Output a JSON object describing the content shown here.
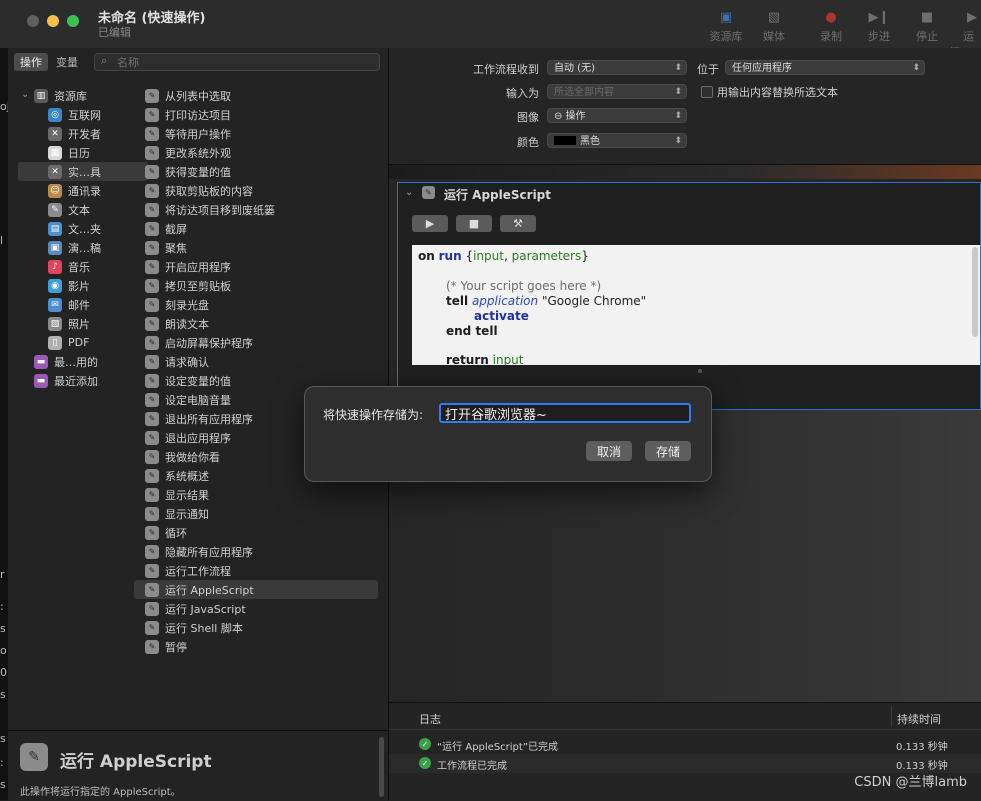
{
  "window": {
    "title": "未命名 (快速操作)",
    "subtitle": "已编辑"
  },
  "toolbar": {
    "buttons": [
      {
        "label": "资源库",
        "icon": "library-icon"
      },
      {
        "label": "媒体",
        "icon": "media-icon"
      },
      {
        "label": "录制",
        "icon": "record-icon"
      },
      {
        "label": "步进",
        "icon": "step-icon"
      },
      {
        "label": "停止",
        "icon": "stop-icon"
      },
      {
        "label": "运行",
        "icon": "run-icon"
      }
    ]
  },
  "library": {
    "tabs": [
      "操作",
      "变量"
    ],
    "search_placeholder": "名称",
    "categories": [
      {
        "label": "资源库",
        "color": "#5a5a5a",
        "glyph": "▥"
      },
      {
        "label": "互联网",
        "color": "#3a86c8",
        "glyph": "◎"
      },
      {
        "label": "开发者",
        "color": "#6a6a6a",
        "glyph": "✕"
      },
      {
        "label": "日历",
        "color": "#d9d9d9",
        "glyph": "▦"
      },
      {
        "label": "实…具",
        "color": "#6a6a6a",
        "glyph": "✕"
      },
      {
        "label": "通讯录",
        "color": "#b98a4e",
        "glyph": "☺"
      },
      {
        "label": "文本",
        "color": "#8b8b8b",
        "glyph": "✎"
      },
      {
        "label": "文…夹",
        "color": "#4a8fd1",
        "glyph": "▤"
      },
      {
        "label": "演…稿",
        "color": "#5a8bc0",
        "glyph": "▣"
      },
      {
        "label": "音乐",
        "color": "#e0455b",
        "glyph": "♪"
      },
      {
        "label": "影片",
        "color": "#3f9fd8",
        "glyph": "◉"
      },
      {
        "label": "邮件",
        "color": "#4a8fd1",
        "glyph": "✉"
      },
      {
        "label": "照片",
        "color": "#8b8b8b",
        "glyph": "▧"
      },
      {
        "label": "PDF",
        "color": "#b0b0b0",
        "glyph": "▯"
      },
      {
        "label": "最…用的",
        "color": "#9b59b6",
        "glyph": "▬"
      },
      {
        "label": "最近添加",
        "color": "#9b59b6",
        "glyph": "▬"
      }
    ],
    "actions": [
      "从列表中选取",
      "打印访达项目",
      "等待用户操作",
      "更改系统外观",
      "获得变量的值",
      "获取剪贴板的内容",
      "将访达项目移到废纸篓",
      "截屏",
      "聚焦",
      "开启应用程序",
      "拷贝至剪贴板",
      "刻录光盘",
      "朗读文本",
      "启动屏幕保护程序",
      "请求确认",
      "设定变量的值",
      "设定电脑音量",
      "退出所有应用程序",
      "退出应用程序",
      "我做给你看",
      "系统概述",
      "显示结果",
      "显示通知",
      "循环",
      "隐藏所有应用程序",
      "运行工作流程",
      "运行 AppleScript",
      "运行 JavaScript",
      "运行 Shell 脚本",
      "暂停"
    ],
    "selected_action_index": 26,
    "description": {
      "title": "运行 AppleScript",
      "text": "此操作将运行指定的 AppleScript。"
    }
  },
  "workflow_settings": {
    "receives_label": "工作流程收到",
    "receives_value": "自动 (无)",
    "in_label": "位于",
    "in_value": "任何应用程序",
    "input_label": "输入为",
    "input_value": "所选全部内容",
    "replace_label": "用输出内容替换所选文本",
    "image_label": "图像",
    "image_value": "⊖ 操作",
    "color_label": "颜色",
    "color_value": "黑色"
  },
  "action": {
    "title": "运行 AppleScript",
    "run_glyph": "▶",
    "stop_glyph": "■",
    "compile_glyph": "⚒",
    "code": {
      "l1_kw1": "on",
      "l1_kw2": "run",
      "l1_args_open": " {",
      "l1_arg1": "input",
      "l1_sep": ", ",
      "l1_arg2": "parameters",
      "l1_args_close": "}",
      "l2_comment": "(* Your script goes here *)",
      "l3_kw": "tell",
      "l3_app": "application",
      "l3_str": " \"Google Chrome\"",
      "l4_kw": "activate",
      "l5_kw": "end tell",
      "l6_kw": "return",
      "l6_var": "input"
    }
  },
  "log": {
    "header_log": "日志",
    "header_duration": "持续时间",
    "rows": [
      {
        "message": "“运行 AppleScript”已完成",
        "duration": "0.133 秒钟"
      },
      {
        "message": "工作流程已完成",
        "duration": "0.133 秒钟"
      }
    ]
  },
  "dialog": {
    "label": "将快速操作存储为:",
    "value": "打开谷歌浏览器~",
    "cancel": "取消",
    "save": "存储"
  },
  "watermark": "CSDN @兰博lamb",
  "left_edge_glyphs": [
    "oj",
    "l",
    "r",
    ":",
    "s",
    "o",
    "0",
    "s",
    "s",
    ":",
    "s"
  ]
}
